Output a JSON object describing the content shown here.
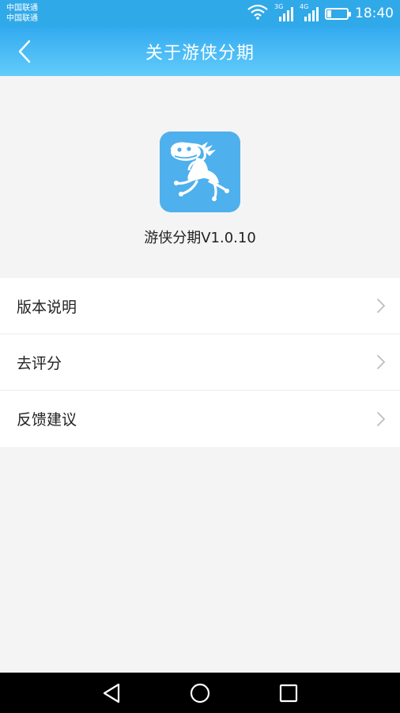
{
  "status_bar": {
    "carrier_1": "中国联通",
    "carrier_2": "中国联通",
    "network_1": "3G",
    "network_2": "4G",
    "time": "18:40",
    "battery_level": 0.2
  },
  "header": {
    "title": "关于游侠分期"
  },
  "about": {
    "version_text": "游侠分期V1.0.10"
  },
  "menu": {
    "items": [
      {
        "label": "版本说明"
      },
      {
        "label": "去评分"
      },
      {
        "label": "反馈建议"
      }
    ]
  },
  "colors": {
    "accent": "#33aaf0",
    "icon_bg": "#4eb0ec",
    "background": "#f4f4f4"
  }
}
